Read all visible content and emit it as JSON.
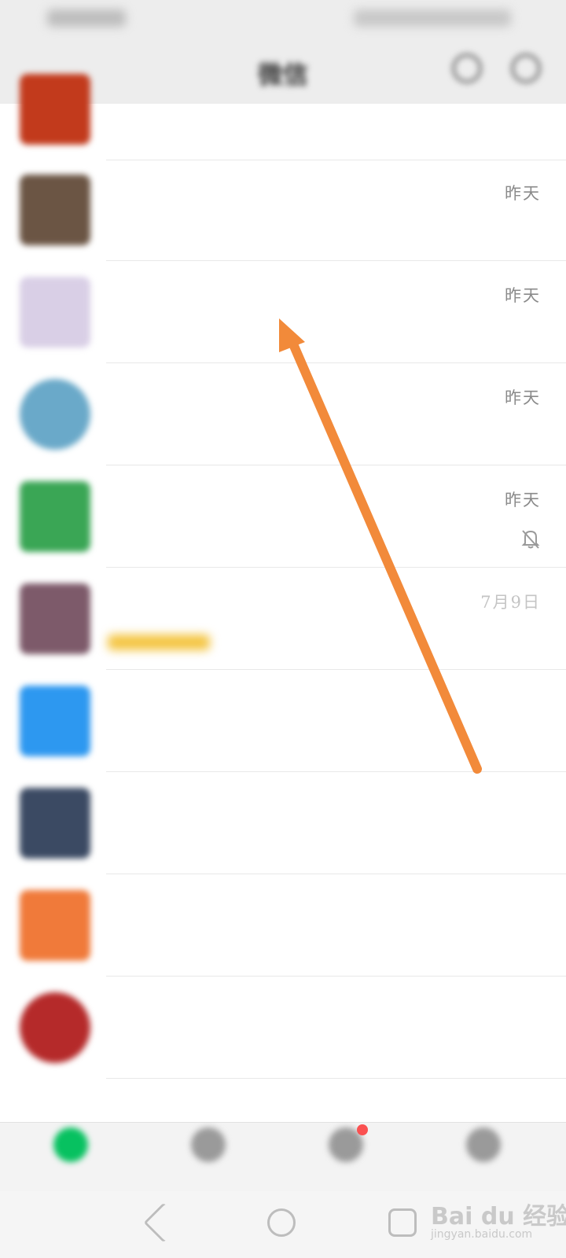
{
  "title_bar": {
    "title": "微信"
  },
  "chats": [
    {
      "name": "",
      "preview": "",
      "time": "",
      "muted": false,
      "avatar_color": "#c23a1c",
      "avatar_round": false,
      "name_blue": false,
      "time_light": false
    },
    {
      "name": "",
      "preview": "",
      "time": "昨天",
      "muted": false,
      "avatar_color": "#6b5544",
      "avatar_round": false,
      "name_blue": false,
      "time_light": false
    },
    {
      "name": "",
      "preview": "",
      "time": "昨天",
      "muted": false,
      "avatar_color": "#d9cfe6",
      "avatar_round": false,
      "name_blue": false,
      "time_light": false
    },
    {
      "name": "",
      "preview": "",
      "time": "昨天",
      "muted": false,
      "avatar_color": "#6aa9c9",
      "avatar_round": true,
      "name_blue": true,
      "time_light": false
    },
    {
      "name": "",
      "preview": "",
      "time": "昨天",
      "muted": true,
      "avatar_color": "#3aa655",
      "avatar_round": false,
      "name_blue": false,
      "time_light": false
    },
    {
      "name": "",
      "preview": "",
      "time": "7月9日",
      "muted": false,
      "avatar_color": "#7d5a6a",
      "avatar_round": false,
      "name_blue": false,
      "time_light": true
    },
    {
      "name": "",
      "preview": "",
      "time": "",
      "muted": false,
      "avatar_color": "#2d98f0",
      "avatar_round": false,
      "name_blue": true,
      "time_light": true
    },
    {
      "name": "",
      "preview": "",
      "time": "",
      "muted": false,
      "avatar_color": "#3b4a63",
      "avatar_round": false,
      "name_blue": false,
      "time_light": true
    },
    {
      "name": "",
      "preview": "",
      "time": "",
      "muted": false,
      "avatar_color": "#f07a3a",
      "avatar_round": false,
      "name_blue": true,
      "time_light": true
    },
    {
      "name": "",
      "preview": "",
      "time": "",
      "muted": false,
      "avatar_color": "#b52a2a",
      "avatar_round": true,
      "name_blue": true,
      "time_light": true
    }
  ],
  "bottom_nav": [
    {
      "label": "",
      "icon": "chat-icon",
      "color": "#07c160",
      "badge": false
    },
    {
      "label": "",
      "icon": "contacts-icon",
      "color": "#9a9a9a",
      "badge": false
    },
    {
      "label": "",
      "icon": "discover-icon",
      "color": "#9a9a9a",
      "badge": true
    },
    {
      "label": "",
      "icon": "me-icon",
      "color": "#9a9a9a",
      "badge": false
    }
  ],
  "watermark": {
    "main": "Bai du 经验",
    "sub": "jingyan.baidu.com"
  },
  "colors": {
    "accent": "#07c160",
    "arrow": "#f28a3a",
    "badge": "#fa5151"
  }
}
